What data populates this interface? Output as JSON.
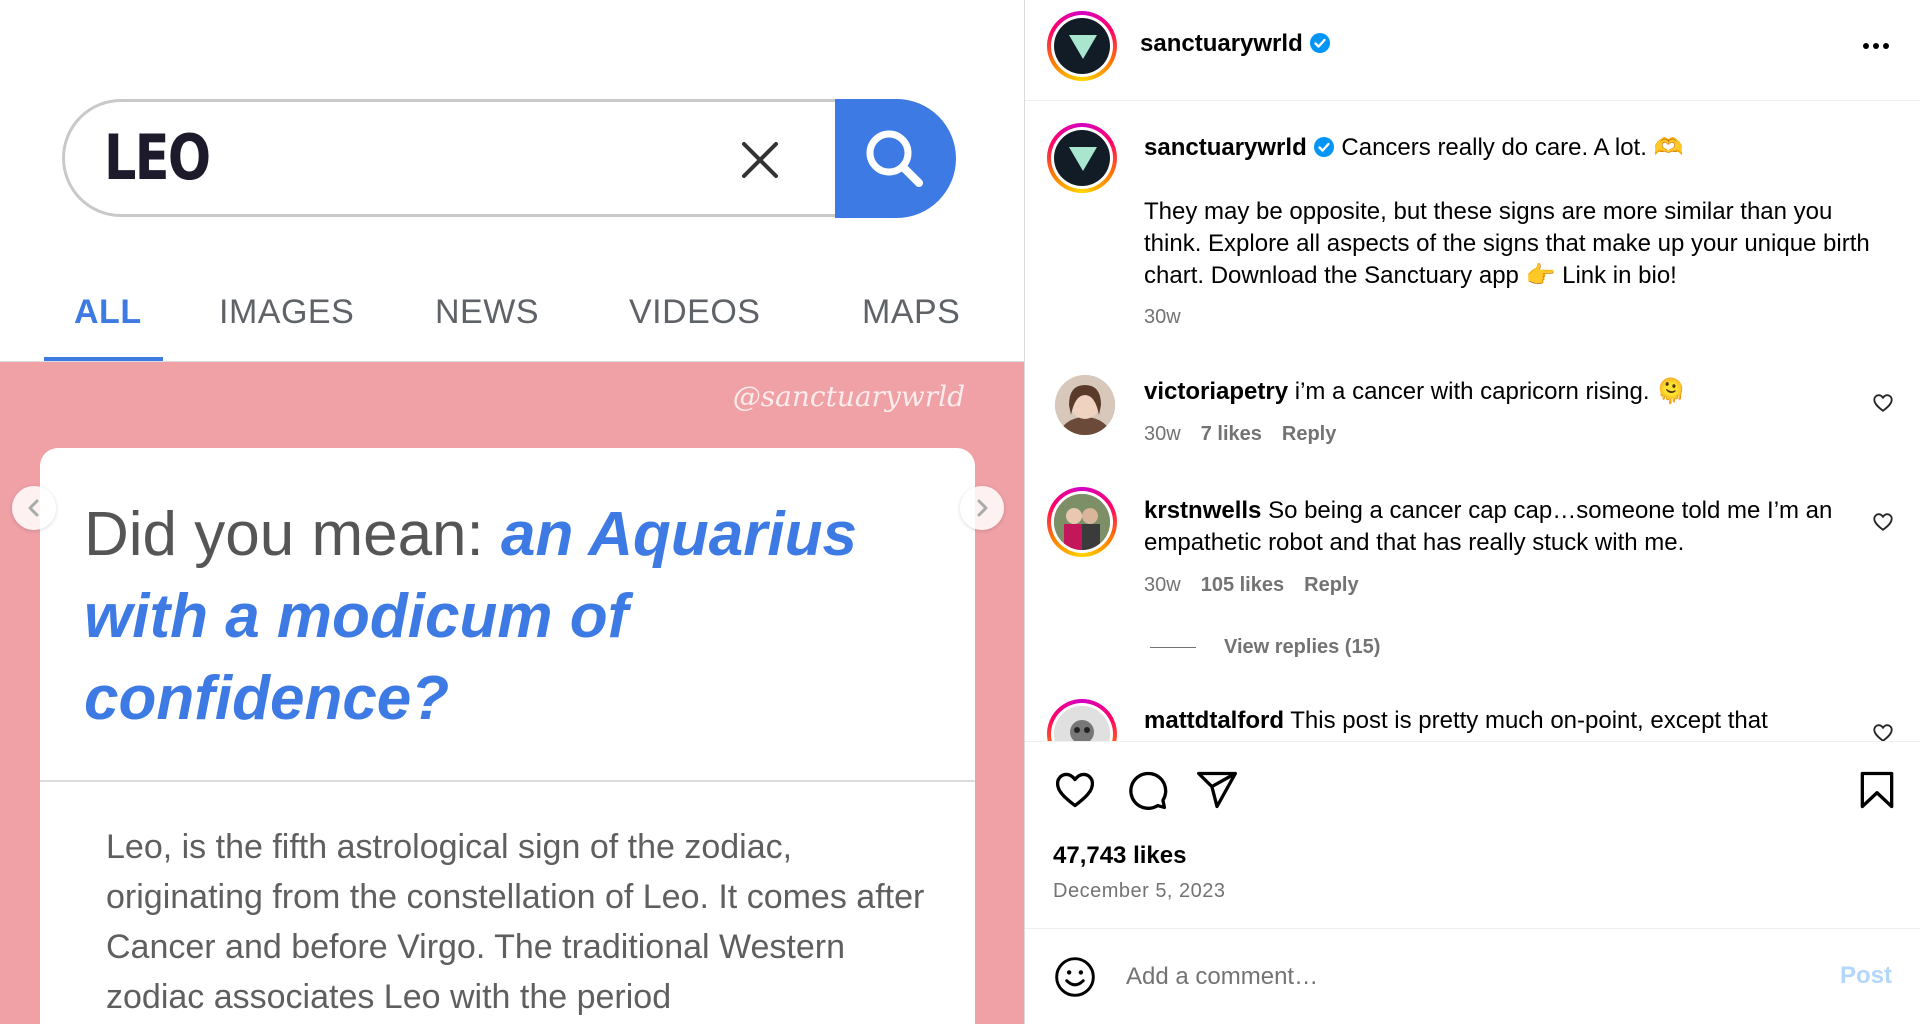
{
  "media": {
    "search": {
      "query": "LEO"
    },
    "tabs": [
      "ALL",
      "IMAGES",
      "NEWS",
      "VIDEOS",
      "MAPS"
    ],
    "active_tab": "ALL",
    "watermark": "@sanctuarywrld",
    "card": {
      "question_prefix": "Did you mean: ",
      "question_highlight": "an Aquarius with a modicum of confidence?",
      "body": "Leo, is the fifth astrological sign of the zodiac, originating from the constellation of Leo. It comes after Cancer and before Virgo. The traditional Western zodiac associates Leo with the period"
    },
    "colors": {
      "accent": "#3d7ae3",
      "background": "#efa1a6"
    }
  },
  "header": {
    "username": "sanctuarywrld"
  },
  "caption": {
    "username": "sanctuarywrld",
    "headline": "Cancers really do care. A lot. 🫶",
    "body": "They may be opposite, but these signs are more similar than you think. Explore all aspects of the signs that make up your unique birth chart. Download the Sanctuary app 👉 Link in bio!",
    "time": "30w"
  },
  "comments": [
    {
      "username": "victoriapetry",
      "text": "i’m a cancer with capricorn rising. 🫠",
      "time": "30w",
      "likes": "7 likes",
      "reply": "Reply"
    },
    {
      "username": "krstnwells",
      "text": "So being a cancer cap cap…someone told me I’m an empathetic robot and that has really stuck with me.",
      "time": "30w",
      "likes": "105 likes",
      "reply": "Reply",
      "view_replies": "View replies (15)"
    },
    {
      "username": "mattdtalford",
      "text": "This post is pretty much on-point, except that"
    }
  ],
  "likes": "47,743 likes",
  "date": "December 5, 2023",
  "comment_box": {
    "placeholder": "Add a comment…",
    "post_label": "Post"
  },
  "colors": {
    "verified": "#0095f6",
    "post_disabled": "#b3d7fc"
  }
}
